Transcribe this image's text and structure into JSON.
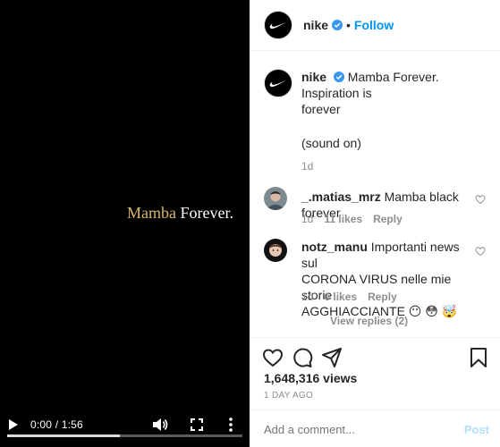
{
  "video": {
    "title_part1": "Mamba",
    "title_part2": " Forever.",
    "time": "0:00 / 1:56",
    "progress": 0.48
  },
  "header": {
    "username": "nike",
    "separator": "•",
    "follow_label": "Follow"
  },
  "caption": {
    "username": "nike",
    "text_line1": "Mamba Forever. Inspiration is",
    "text_line2": "forever",
    "text_sound": "(sound on)",
    "age": "1d"
  },
  "comments": [
    {
      "username": "_.matias_mrz",
      "text": "Mamba black forever",
      "age": "1d",
      "likes": "11 likes",
      "reply_label": "Reply"
    },
    {
      "username": "notz_manu",
      "text_line1": "Importanti news sul",
      "text_line2": "CORONA VIRUS nelle mie storie",
      "text_line3": "AGGHIACCIANTE 😶 😳 🤯",
      "age": "1d",
      "likes": "6 likes",
      "reply_label": "Reply"
    }
  ],
  "view_replies": "View replies (2)",
  "stats": {
    "views": "1,648,316 views",
    "posted": "1 DAY AGO"
  },
  "add_comment": {
    "placeholder": "Add a comment...",
    "post_label": "Post"
  },
  "icons": [
    "play-icon",
    "volume-icon",
    "fullscreen-icon",
    "more-icon",
    "heart-icon",
    "comment-icon",
    "share-icon",
    "bookmark-icon",
    "verified-icon",
    "swoosh-icon"
  ],
  "colors": {
    "accent": "#0095f6",
    "post_disabled": "#b2dffc",
    "gold_text": "#d9b76a",
    "muted": "#8e8e8e"
  }
}
